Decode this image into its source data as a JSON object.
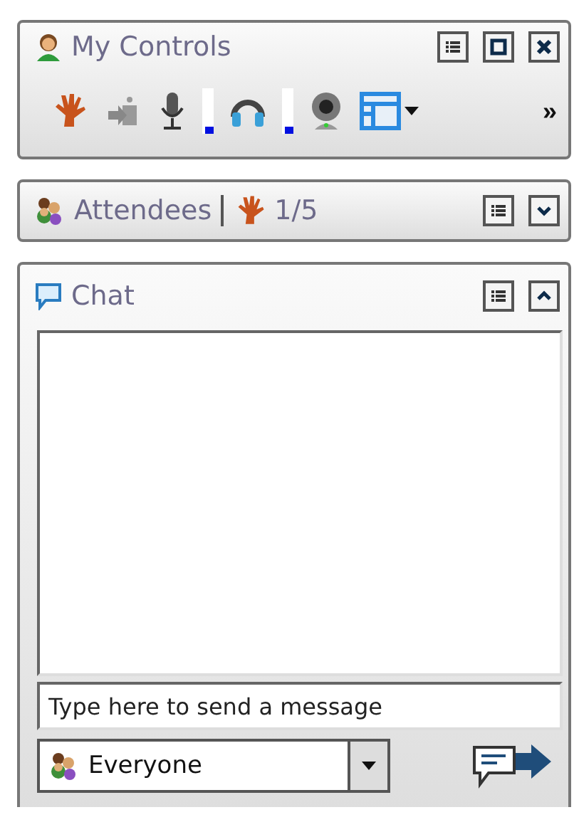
{
  "my_controls": {
    "title": "My Controls",
    "mic_meter": {
      "level": 0.15
    },
    "speaker_meter": {
      "level": 0.15
    },
    "more": "»"
  },
  "attendees": {
    "title": "Attendees",
    "raised_hands": "1/5",
    "expanded": false
  },
  "chat": {
    "title": "Chat",
    "expanded": true,
    "message_field": {
      "placeholder": "Type here to send a message"
    },
    "recipient": {
      "value": "Everyone"
    }
  }
}
